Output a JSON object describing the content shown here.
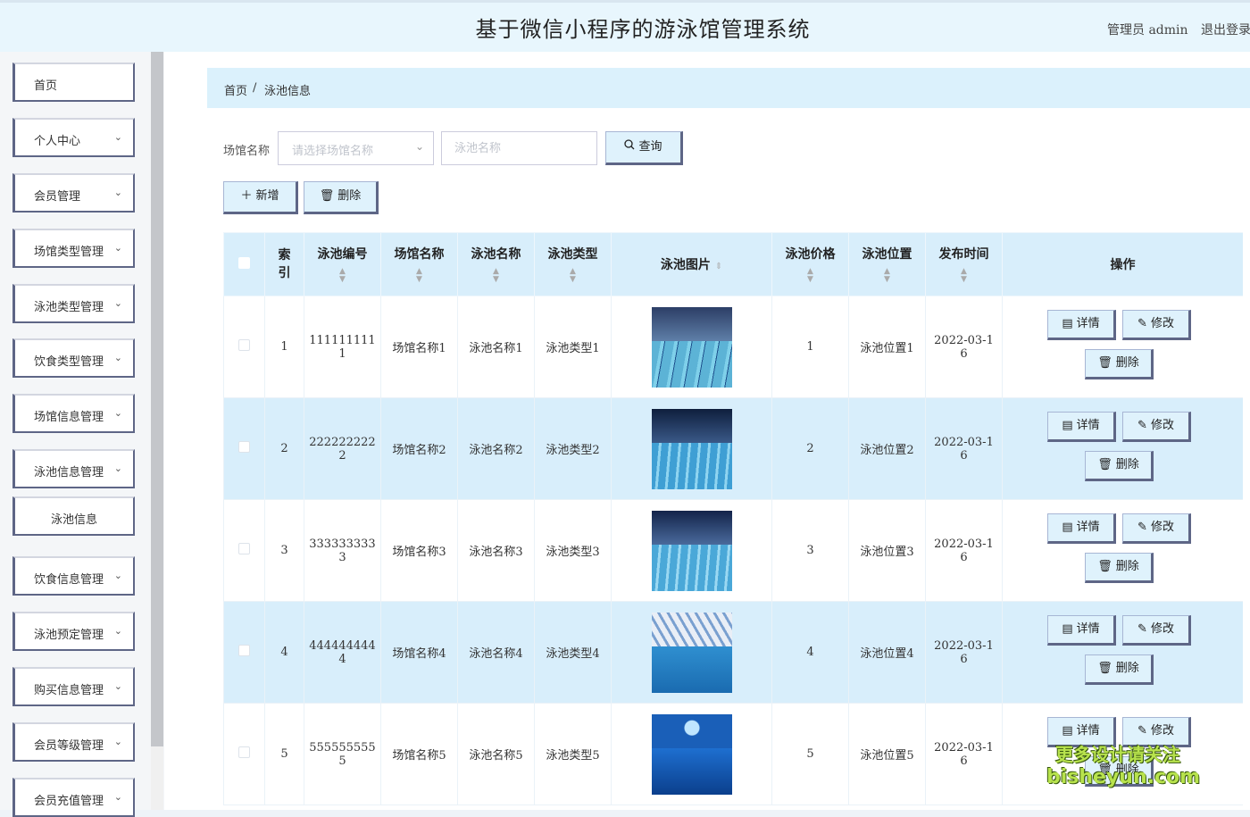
{
  "header": {
    "title": "基于微信小程序的游泳馆管理系统",
    "user": "管理员 admin",
    "logout": "退出登录"
  },
  "sidebar": {
    "items": [
      {
        "label": "首页",
        "arrow": ""
      },
      {
        "label": "个人中心",
        "arrow": "⌄"
      },
      {
        "label": "会员管理",
        "arrow": "⌄"
      },
      {
        "label": "场馆类型管理",
        "arrow": "⌄"
      },
      {
        "label": "泳池类型管理",
        "arrow": "⌄"
      },
      {
        "label": "饮食类型管理",
        "arrow": "⌄"
      },
      {
        "label": "场馆信息管理",
        "arrow": "⌄"
      },
      {
        "label": "泳池信息管理",
        "arrow": "⌄"
      },
      {
        "label": "泳池信息",
        "arrow": ""
      },
      {
        "label": "饮食信息管理",
        "arrow": "⌄"
      },
      {
        "label": "泳池预定管理",
        "arrow": "⌄"
      },
      {
        "label": "购买信息管理",
        "arrow": "⌄"
      },
      {
        "label": "会员等级管理",
        "arrow": "⌄"
      },
      {
        "label": "会员充值管理",
        "arrow": "⌄"
      }
    ]
  },
  "breadcrumb": {
    "home": "首页",
    "sep": "/",
    "current": "泳池信息"
  },
  "search": {
    "label": "场馆名称",
    "select_placeholder": "请选择场馆名称",
    "input_placeholder": "泳池名称",
    "query_label": "查询"
  },
  "toolbar": {
    "add_label": "新增",
    "delete_label": "删除"
  },
  "table": {
    "headers": {
      "index": "索引",
      "code": "泳池编号",
      "venue": "场馆名称",
      "name": "泳池名称",
      "type": "泳池类型",
      "image": "泳池图片",
      "price": "泳池价格",
      "location": "泳池位置",
      "time": "发布时间",
      "ops": "操作"
    },
    "actions": {
      "detail": "详情",
      "edit": "修改",
      "delete": "删除"
    },
    "rows": [
      {
        "index": "1",
        "code_a": "111111111",
        "code_b": "1",
        "venue": "场馆名称1",
        "name": "泳池名称1",
        "type": "泳池类型1",
        "price": "1",
        "location": "泳池位置1",
        "time_a": "2022-03-1",
        "time_b": "6"
      },
      {
        "index": "2",
        "code_a": "222222222",
        "code_b": "2",
        "venue": "场馆名称2",
        "name": "泳池名称2",
        "type": "泳池类型2",
        "price": "2",
        "location": "泳池位置2",
        "time_a": "2022-03-1",
        "time_b": "6"
      },
      {
        "index": "3",
        "code_a": "333333333",
        "code_b": "3",
        "venue": "场馆名称3",
        "name": "泳池名称3",
        "type": "泳池类型3",
        "price": "3",
        "location": "泳池位置3",
        "time_a": "2022-03-1",
        "time_b": "6"
      },
      {
        "index": "4",
        "code_a": "444444444",
        "code_b": "4",
        "venue": "场馆名称4",
        "name": "泳池名称4",
        "type": "泳池类型4",
        "price": "4",
        "location": "泳池位置4",
        "time_a": "2022-03-1",
        "time_b": "6"
      },
      {
        "index": "5",
        "code_a": "555555555",
        "code_b": "5",
        "venue": "场馆名称5",
        "name": "泳池名称5",
        "type": "泳池类型5",
        "price": "5",
        "location": "泳池位置5",
        "time_a": "2022-03-1",
        "time_b": "6"
      }
    ]
  },
  "watermark": {
    "line1": "更多设计请关注",
    "line2": "bisheyun.com"
  },
  "colors": {
    "accent": "#dbf1fc",
    "border": "#5e6686",
    "stripe": "#d8eefb"
  }
}
